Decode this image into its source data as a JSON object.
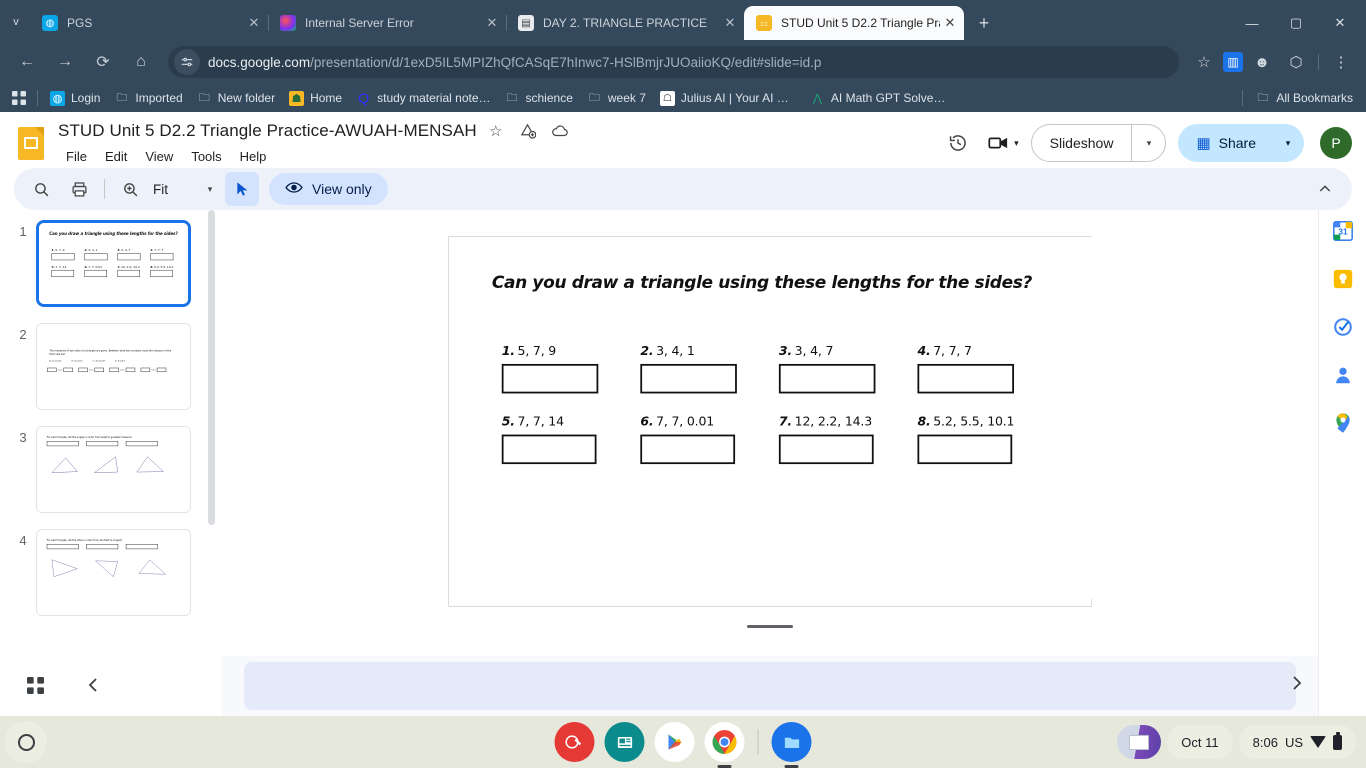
{
  "browser": {
    "tabs": [
      {
        "title": "PGS",
        "favicon": "drop-icon",
        "active": false
      },
      {
        "title": "Internal Server Error",
        "favicon": "colorful-icon",
        "active": false
      },
      {
        "title": "DAY 2. TRIANGLE PRACTICE",
        "favicon": "doc-icon",
        "active": false
      },
      {
        "title": "STUD Unit 5 D2.2 Triangle Prac",
        "favicon": "slides-icon",
        "active": true
      }
    ],
    "new_tab_label": "+",
    "tab_list_label": "v",
    "window_controls": {
      "minimize": "—",
      "maximize": "▢",
      "close": "✕"
    },
    "nav": {
      "back": "←",
      "forward": "→",
      "reload": "⟳",
      "home": "⌂"
    },
    "url": {
      "domain": "docs.google.com",
      "path": "/presentation/d/1exD5IL5MPIZhQfCASqE7hInwc7-HSlBmjrJUOaiioKQ/edit#slide=id.p",
      "site_icon": "site-settings-icon"
    },
    "omni_actions": [
      {
        "name": "bookmark-star-icon",
        "glyph": "☆"
      },
      {
        "name": "extension-blue-icon",
        "glyph": "▥"
      },
      {
        "name": "extension-dark-icon",
        "glyph": "☻"
      },
      {
        "name": "extensions-puzzle-icon",
        "glyph": "⬡"
      }
    ],
    "menu_label": "⋮",
    "profile_label": "◑",
    "bookmarks": [
      {
        "label": "Login",
        "icon": "drop-icon"
      },
      {
        "label": "Imported",
        "icon": "folder-icon"
      },
      {
        "label": "New folder",
        "icon": "folder-icon"
      },
      {
        "label": "Home",
        "icon": "contact-icon"
      },
      {
        "label": "study material note…",
        "icon": "quora-icon"
      },
      {
        "label": "schience",
        "icon": "folder-icon"
      },
      {
        "label": "week 7",
        "icon": "folder-icon"
      },
      {
        "label": "Julius AI | Your AI D…",
        "icon": "julius-icon"
      },
      {
        "label": "AI Math GPT Solver…",
        "icon": "compass-icon"
      }
    ],
    "all_bookmarks": {
      "label": "All Bookmarks",
      "icon": "folder-icon"
    },
    "apps_grid_label": "apps-grid-icon"
  },
  "slides": {
    "doc_title": "STUD Unit 5 D2.2 Triangle Practice-AWUAH-MENSAH",
    "title_icons": [
      {
        "name": "star-icon",
        "glyph": "☆"
      },
      {
        "name": "move-to-drive-icon",
        "glyph": "△"
      },
      {
        "name": "cloud-saved-icon",
        "glyph": "☁"
      }
    ],
    "menu": [
      "File",
      "Edit",
      "View",
      "Tools",
      "Help"
    ],
    "header_right": {
      "version_history_icon": "history-icon",
      "meet_icon": "camera-icon",
      "meet_caret": "▾",
      "slideshow_label": "Slideshow",
      "slideshow_caret": "▾",
      "share_label": "Share",
      "share_icon": "building-icon",
      "share_caret": "▾",
      "avatar_initial": "P"
    },
    "toolbar": {
      "search_icon": "search-icon",
      "print_icon": "print-icon",
      "zoom_icon": "zoom-icon",
      "zoom_value": "Fit",
      "zoom_caret": "▾",
      "cursor_icon": "select-cursor-icon",
      "view_only_label": "View only",
      "view_only_icon": "eye-icon",
      "collapse_icon": "chevron-up-icon"
    },
    "filmstrip": {
      "slides": [
        {
          "number": "1",
          "active": true
        },
        {
          "number": "2",
          "active": false
        },
        {
          "number": "3",
          "active": false
        },
        {
          "number": "4",
          "active": false
        }
      ],
      "grid_view_icon": "grid-view-icon",
      "collapse_icon": "chevron-left-icon"
    },
    "notes": {
      "next_icon": "chevron-right-icon"
    },
    "side_rail": [
      {
        "name": "google-calendar-icon",
        "glyph": "31"
      },
      {
        "name": "google-keep-icon",
        "glyph": "♥"
      },
      {
        "name": "google-tasks-icon",
        "glyph": "✓"
      },
      {
        "name": "google-contacts-icon",
        "glyph": "●"
      },
      {
        "name": "google-maps-icon",
        "glyph": "◉"
      }
    ]
  },
  "slide_content": {
    "question": "Can you draw a triangle using these lengths for the sides?",
    "problems": [
      {
        "num": "1.",
        "lengths": "5, 7, 9",
        "answer": ""
      },
      {
        "num": "2.",
        "lengths": "3, 4, 1",
        "answer": ""
      },
      {
        "num": "3.",
        "lengths": "3, 4, 7",
        "answer": ""
      },
      {
        "num": "4.",
        "lengths": "7, 7, 7",
        "answer": ""
      },
      {
        "num": "5.",
        "lengths": "7, 7, 14",
        "answer": ""
      },
      {
        "num": "6.",
        "lengths": "7, 7, 0.01",
        "answer": ""
      },
      {
        "num": "7.",
        "lengths": "12, 2.2, 14.3",
        "answer": ""
      },
      {
        "num": "8.",
        "lengths": "5.2, 5.5, 10.1",
        "answer": ""
      }
    ],
    "slide2_text": "The measures of two sides of a triangle are given. Between what two numbers must the measure of the third side be?",
    "slide3_text": "For each triangle, list the angles in order from least to greatest measure.",
    "slide4_text": "For each triangle, list the sides in order from shortest to longest."
  },
  "shelf": {
    "launcher_icon": "launcher-icon",
    "apps": [
      {
        "name": "canvas-app-icon",
        "glyph": "✎",
        "color": "#e53935",
        "running": false
      },
      {
        "name": "news-app-icon",
        "glyph": "▤",
        "color": "#0b8b8b",
        "running": false
      },
      {
        "name": "play-store-icon",
        "glyph": "▶",
        "color": "#ffffff",
        "running": false
      },
      {
        "name": "chrome-icon",
        "glyph": "◉",
        "color": "#ffffff",
        "running": true
      },
      {
        "name": "files-app-icon",
        "glyph": "▰",
        "color": "#1a73e8",
        "running": true
      }
    ],
    "date": "Oct 11",
    "time": "8:06",
    "locale": "US",
    "wifi_icon": "wifi-icon",
    "battery_icon": "battery-icon"
  },
  "colors": {
    "chrome_frame": "#35495c",
    "accent_blue": "#1a73e8",
    "share_bg": "#c2e7ff",
    "toolbar_bg": "#edf2fa",
    "shelf_bg": "#e7e8dc",
    "slides_yellow": "#f6b825"
  }
}
